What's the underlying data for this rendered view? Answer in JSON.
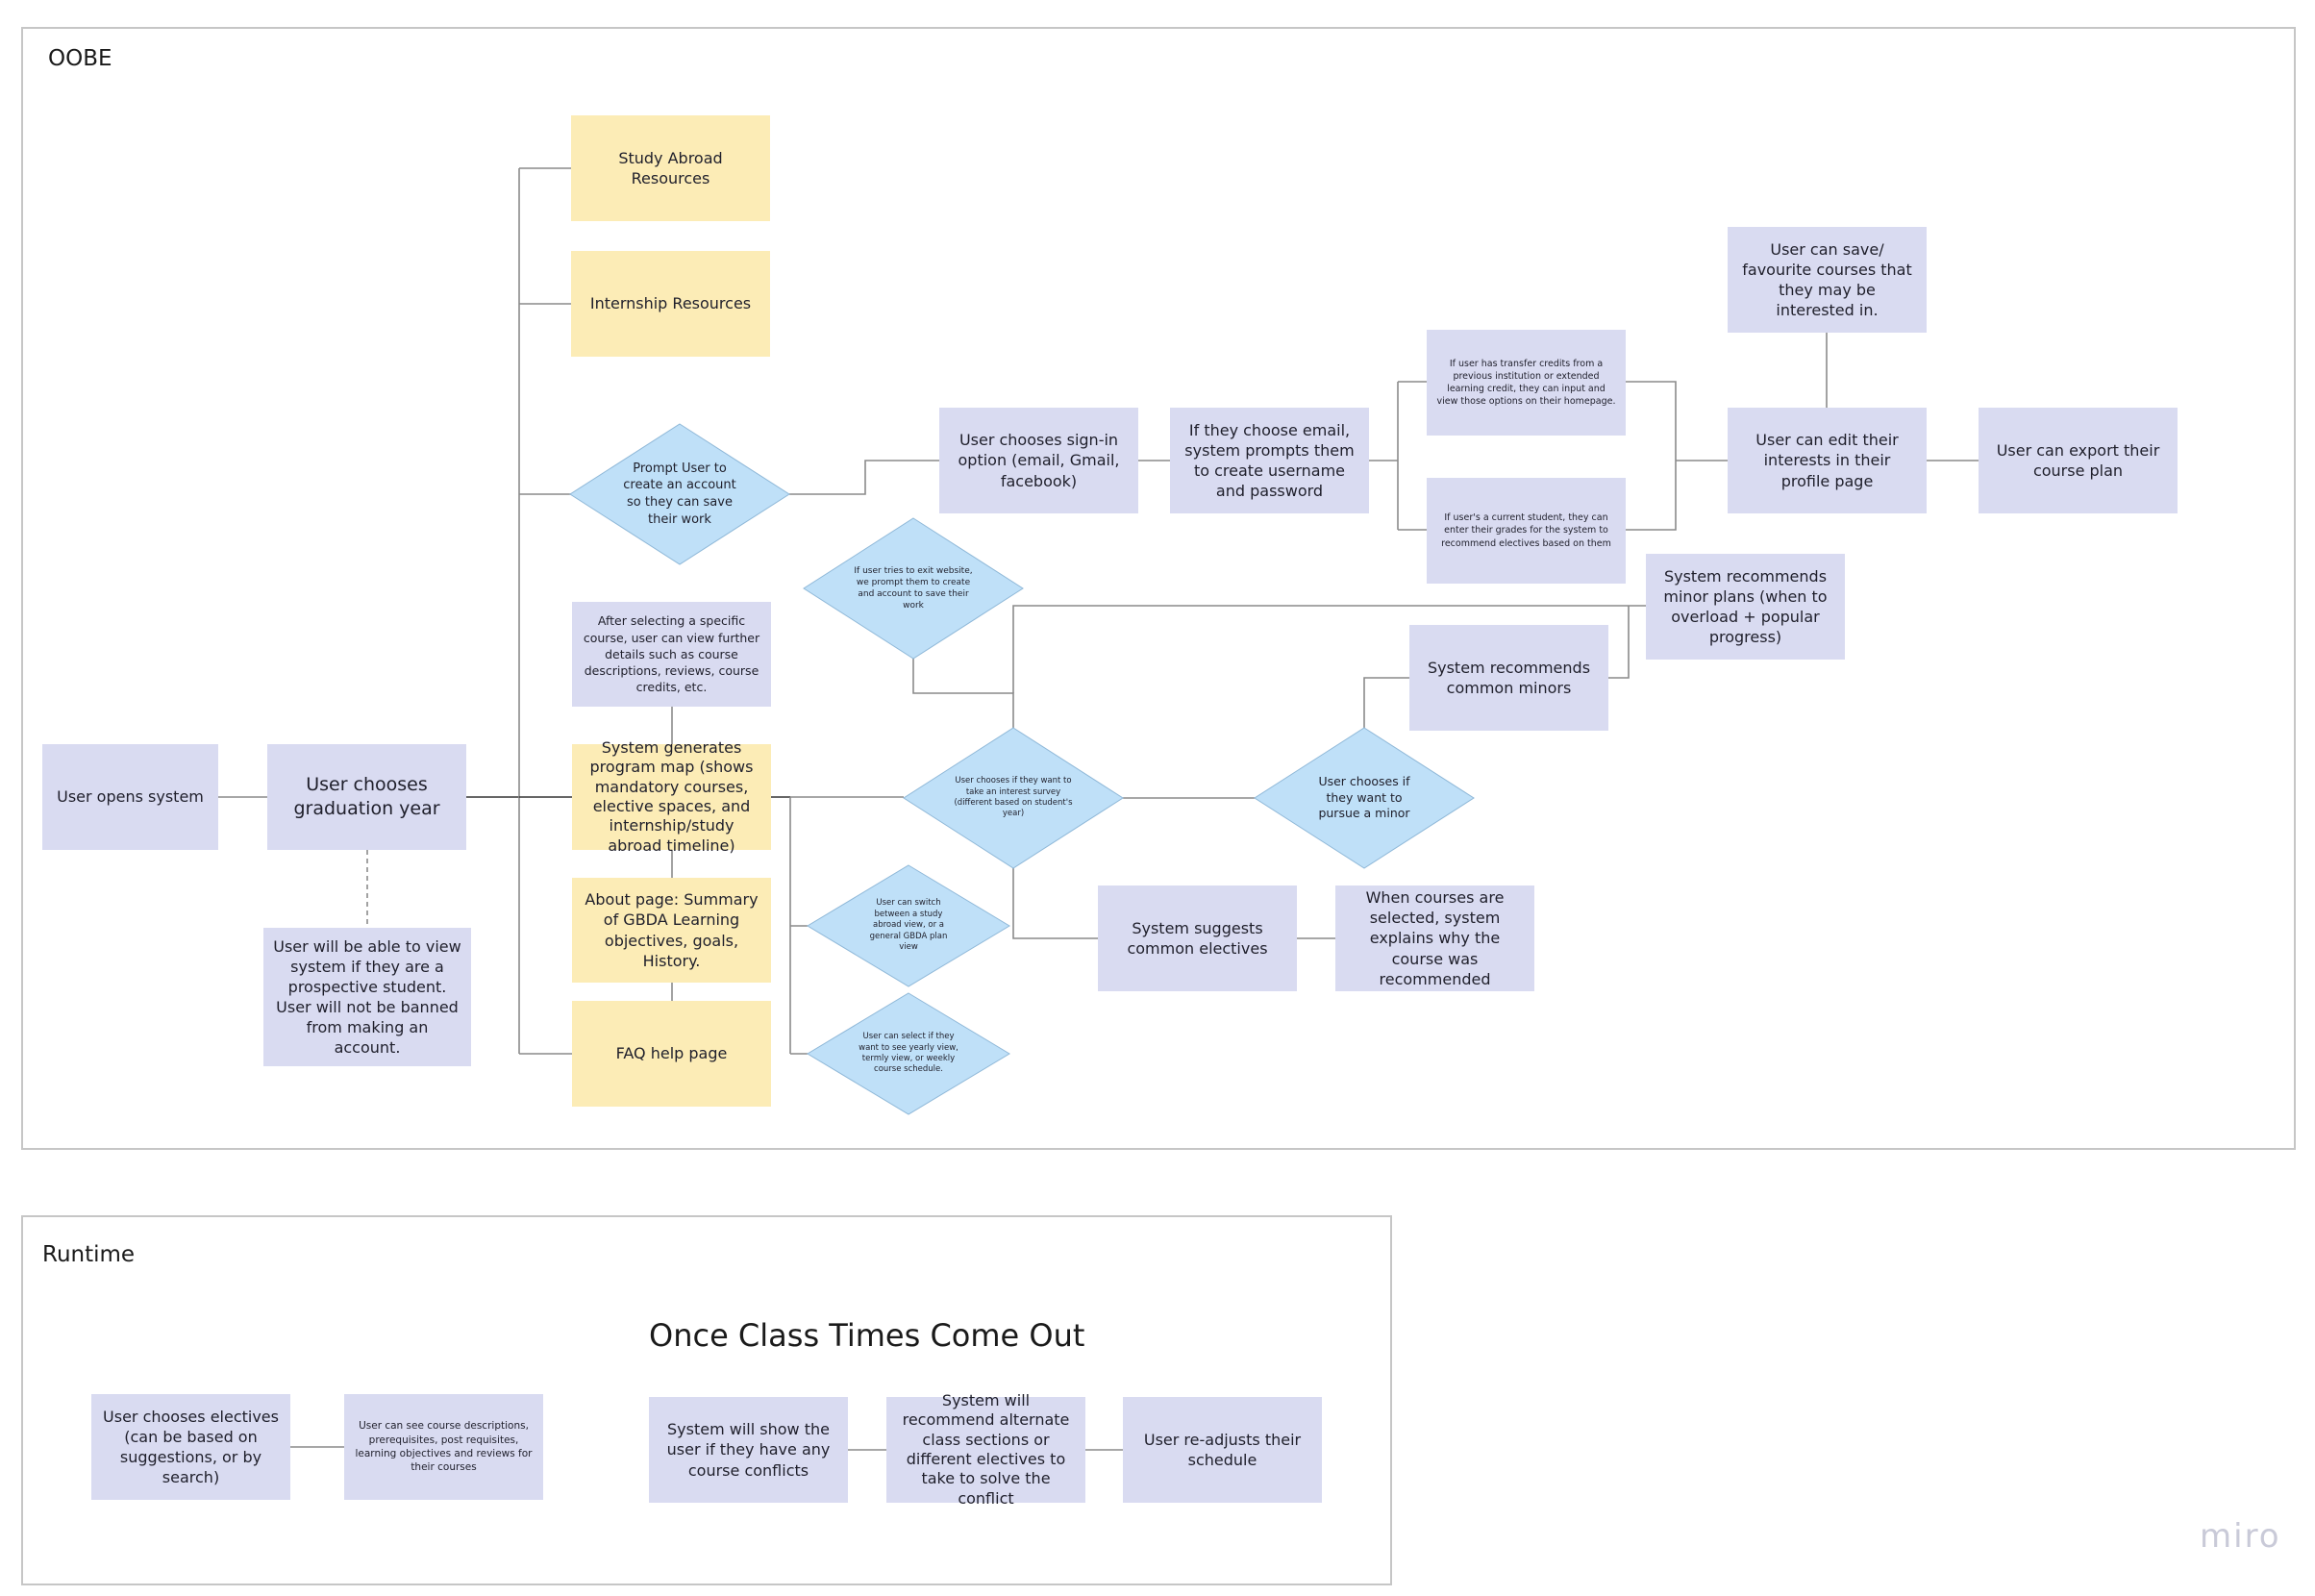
{
  "frames": {
    "oobe": {
      "title": "OOBE"
    },
    "runtime": {
      "title": "Runtime",
      "section_title": "Once Class Times Come Out"
    }
  },
  "colors": {
    "process_box": "#d9dbf1",
    "resource_box": "#fcecb6",
    "decision_diamond": "#bfe0f8",
    "connector": "#8a8a8a",
    "frame_border": "#c6c6c6"
  },
  "oobe_nodes": {
    "opens_system": "User opens system",
    "graduation_year": "User chooses graduation year",
    "prospective_student": "User will be able to view system if they are a prospective student. User will not be banned from making an account.",
    "study_abroad": "Study Abroad Resources",
    "internship": "Internship Resources",
    "prompt_account": "Prompt User to create an account so they can save their work",
    "sign_in_option": "User chooses sign-in option (email, Gmail, facebook)",
    "email_prompt": "If they choose email, system prompts them to create username and password",
    "transfer_credits": "If user has transfer credits from a previous institution or extended learning credit, they can input and view those options on their homepage.",
    "current_student_grades": "If user's a current student, they can enter their grades for the system to recommend electives based on them",
    "save_favourite": "User can save/ favourite courses that they may be interested in.",
    "edit_interests": "User can edit their interests in their profile page",
    "export_plan": "User can export their course plan",
    "exit_prompt": "If user tries to exit website, we prompt them to create and account to save their work",
    "course_details": "After selecting a specific course, user can view further details such as course descriptions, reviews, course credits, etc.",
    "program_map": "System generates program map (shows mandatory courses, elective spaces, and internship/study abroad timeline)",
    "about_page": "About page: Summary of GBDA Learning objectives, goals, History.",
    "faq_page": "FAQ help page",
    "interest_survey": "User chooses if they want to take an interest survey (different based on student's year)",
    "pursue_minor": "User chooses if they want to pursue a minor",
    "common_minors": "System recommends common minors",
    "minor_plans": "System recommends minor plans (when to overload + popular progress)",
    "suggest_electives": "System suggests common electives",
    "explain_recommendation": "When courses are selected, system explains why the course was recommended",
    "switch_view": "User can switch between a study abroad view, or a general GBDA plan view",
    "select_view": "User can select if they want to see yearly view, termly view, or weekly course schedule."
  },
  "runtime_nodes": {
    "choose_electives": "User chooses electives (can be based on suggestions, or by search)",
    "see_descriptions": "User can see course descriptions, prerequisites, post requisites, learning objectives and reviews for their courses",
    "show_conflicts": "System will show the user if they have any course conflicts",
    "recommend_alternates": "System will recommend alternate class sections or different electives to take to solve the conflict",
    "readjust_schedule": "User re-adjusts their schedule"
  },
  "branding": {
    "logo_text": "miro"
  }
}
